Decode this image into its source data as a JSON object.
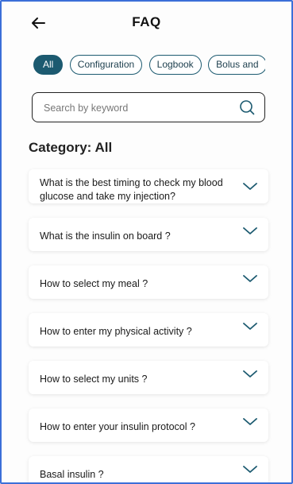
{
  "header": {
    "title": "FAQ",
    "back_icon": "arrow-left-icon"
  },
  "filters": {
    "chips": [
      {
        "label": "All",
        "active": true
      },
      {
        "label": "Configuration",
        "active": false
      },
      {
        "label": "Logbook",
        "active": false
      },
      {
        "label": "Bolus and",
        "active": false
      }
    ]
  },
  "search": {
    "placeholder": "Search by keyword",
    "value": "",
    "icon": "search-icon"
  },
  "category": {
    "label": "Category: All"
  },
  "faq": {
    "items": [
      {
        "question": "What is the best timing to check my blood glucose and take my injection?"
      },
      {
        "question": "What is the insulin on board ?"
      },
      {
        "question": "How to select my meal ?"
      },
      {
        "question": "How to enter my physical activity ?"
      },
      {
        "question": "How to select my units ?"
      },
      {
        "question": "How to enter your insulin protocol ?"
      },
      {
        "question": "Basal insulin ?"
      }
    ]
  },
  "colors": {
    "accent": "#1c5a70",
    "frame": "#3b6fd8"
  }
}
